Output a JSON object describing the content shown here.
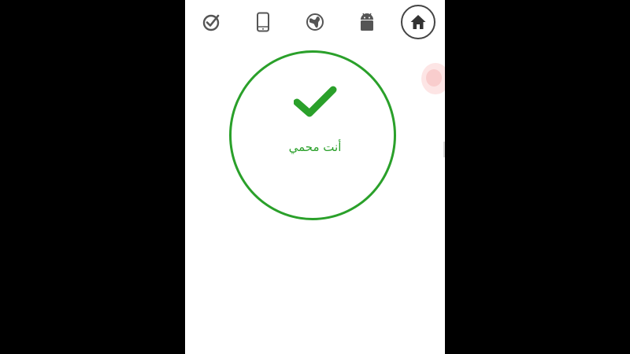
{
  "nav": {
    "items": [
      {
        "icon": "checkmark-circle-icon",
        "active": false
      },
      {
        "icon": "smartphone-icon",
        "active": false
      },
      {
        "icon": "globe-icon",
        "active": false
      },
      {
        "icon": "android-icon",
        "active": false
      },
      {
        "icon": "home-icon",
        "active": true
      }
    ]
  },
  "status": {
    "message": "أنت محمي",
    "icon": "check-icon"
  },
  "colors": {
    "accent_green": "#2aa02a",
    "icon_gray": "#555555",
    "background": "#ffffff",
    "frame": "#000000"
  }
}
